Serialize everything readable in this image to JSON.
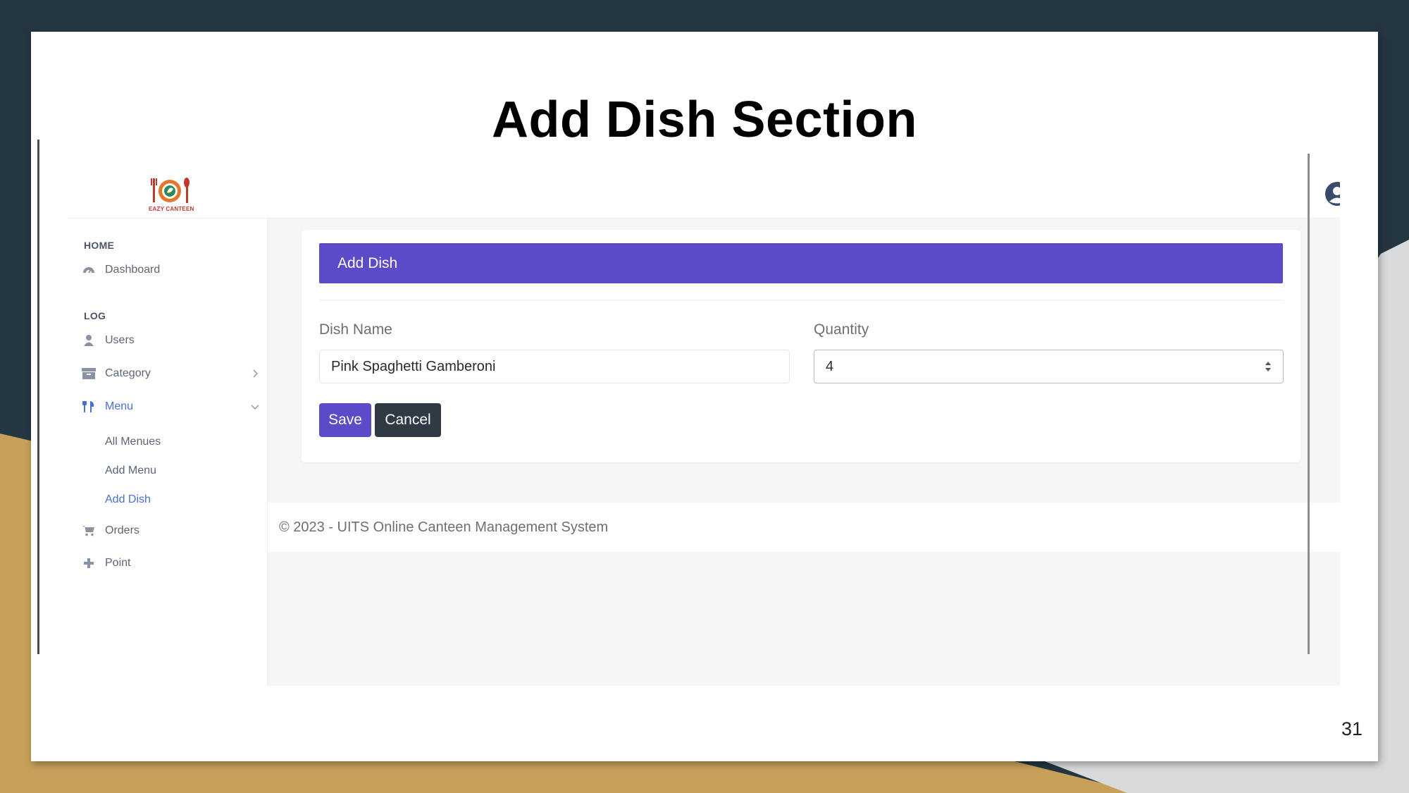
{
  "slide": {
    "title": "Add Dish Section",
    "page_number": "31"
  },
  "app": {
    "logo_text": "EAZY CANTEEN",
    "sidebar": {
      "section_home": "HOME",
      "dashboard": "Dashboard",
      "section_log": "LOG",
      "users": "Users",
      "category": "Category",
      "menu": "Menu",
      "menu_sub": [
        "All Menues",
        "Add Menu",
        "Add Dish"
      ],
      "orders": "Orders",
      "point": "Point"
    },
    "card": {
      "header": "Add Dish",
      "dish_name_label": "Dish Name",
      "dish_name_value": "Pink Spaghetti Gamberoni",
      "quantity_label": "Quantity",
      "quantity_value": "4",
      "save_label": "Save",
      "cancel_label": "Cancel"
    },
    "footer": "© 2023 - UITS Online Canteen Management System"
  },
  "colors": {
    "header_purple": "#5b4bc8",
    "cancel_dark": "#2f3a44",
    "active_link": "#4a6fd1"
  }
}
